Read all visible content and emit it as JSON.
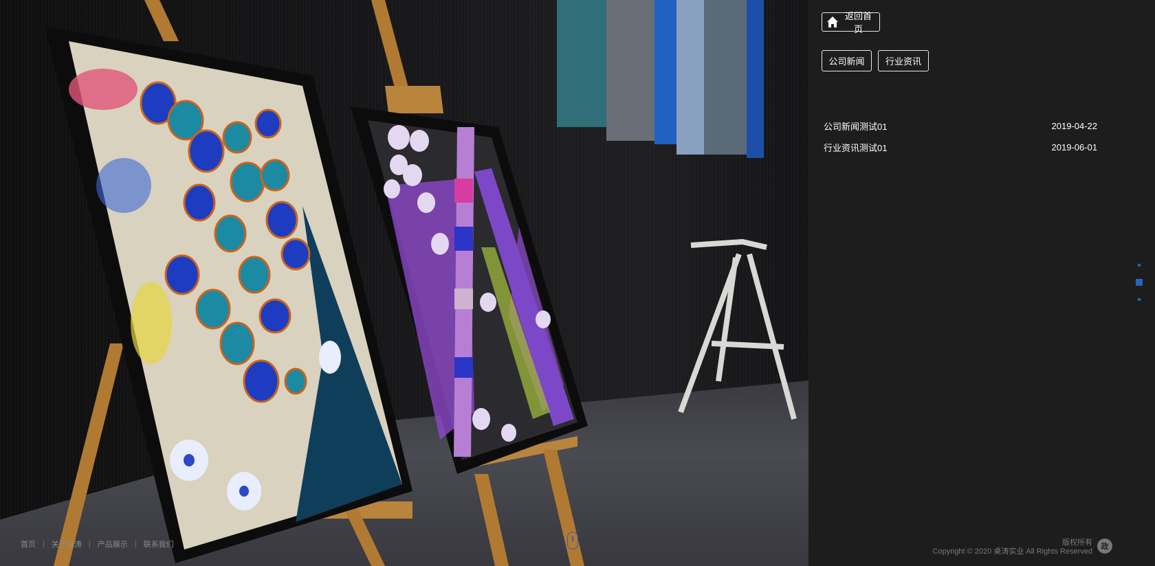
{
  "panel": {
    "home_button_label": "返回首页",
    "tabs": [
      {
        "label": "公司新闻"
      },
      {
        "label": "行业资讯"
      }
    ],
    "news": [
      {
        "title": "公司新闻测试01",
        "date": "2019-04-22"
      },
      {
        "title": "行业资讯测试01",
        "date": "2019-06-01"
      }
    ],
    "rights_text": "版权所有",
    "copyright": "Copyright © 2020 桌涛实业 All Rights Reserved",
    "beian_badge": "政"
  },
  "footer_nav": [
    {
      "label": "首页"
    },
    {
      "label": "关于桌涛"
    },
    {
      "label": "产品展示"
    },
    {
      "label": "联系我们"
    }
  ],
  "colors": {
    "accent": "#2c5fbf",
    "panel_bg": "#1d1d1d",
    "text": "#ffffff",
    "muted": "#7a7a7a"
  },
  "icons": {
    "home": "home-icon",
    "scroll": "mouse-scroll-icon",
    "beian": "government-badge-icon"
  }
}
